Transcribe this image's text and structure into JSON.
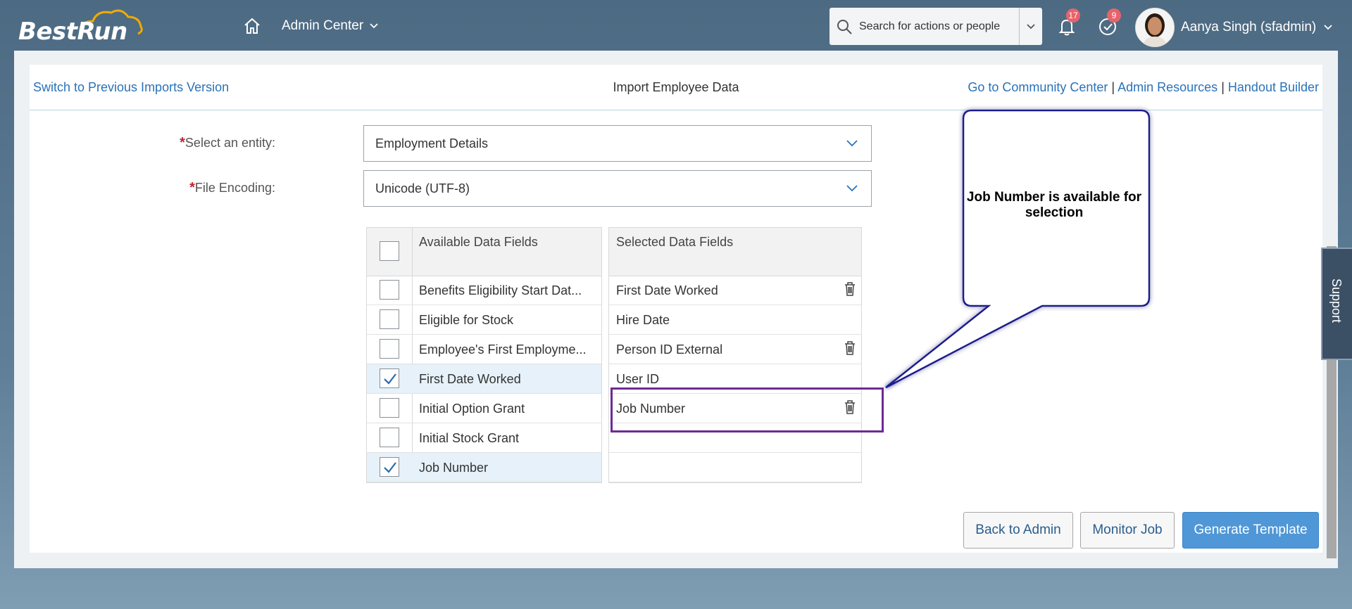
{
  "shell": {
    "logo_best": "Best",
    "logo_run": "Run",
    "admin_menu": "Admin Center",
    "search_placeholder": "Search for actions or people",
    "notifications_count": "17",
    "tasks_count": "9",
    "user_name": "Aanya Singh (sfadmin)"
  },
  "page": {
    "prev_version_link": "Switch to Previous Imports Version",
    "title": "Import Employee Data",
    "links": [
      "Go to Community Center",
      "Admin Resources",
      "Handout Builder"
    ],
    "separator": "|"
  },
  "form": {
    "required_marker": "*",
    "entity_label": "Select an entity:",
    "entity_value": "Employment Details",
    "encoding_label": "File Encoding:",
    "encoding_value": "Unicode (UTF-8)"
  },
  "available": {
    "header": "Available Data Fields",
    "items": [
      {
        "label": "Benefits Eligibility Start Dat...",
        "checked": false
      },
      {
        "label": "Eligible for Stock",
        "checked": false
      },
      {
        "label": "Employee's First Employme...",
        "checked": false
      },
      {
        "label": "First Date Worked",
        "checked": true
      },
      {
        "label": "Initial Option Grant",
        "checked": false
      },
      {
        "label": "Initial Stock Grant",
        "checked": false
      },
      {
        "label": "Job Number",
        "checked": true
      }
    ]
  },
  "selected": {
    "header": "Selected Data Fields",
    "items": [
      {
        "label": "First Date Worked",
        "deletable": true
      },
      {
        "label": "Hire Date",
        "deletable": false
      },
      {
        "label": "Person ID External",
        "deletable": true
      },
      {
        "label": "User ID",
        "deletable": false
      },
      {
        "label": "Job Number",
        "deletable": true
      },
      {
        "label": "",
        "deletable": false
      },
      {
        "label": "",
        "deletable": false
      }
    ]
  },
  "callout": {
    "text": "Job Number is available for selection"
  },
  "support_label": "Support",
  "footer": {
    "back_label": "Back to Admin",
    "monitor_label": "Monitor Job",
    "generate_label": "Generate Template"
  },
  "colors": {
    "shell_bg": "#4d6a83",
    "link": "#2a72b8",
    "primary_button": "#4f97d6",
    "badge": "#e7636b",
    "highlight": "#6d2a95",
    "callout_fill": "#ffffff",
    "callout_border": "#1c1c8c"
  }
}
